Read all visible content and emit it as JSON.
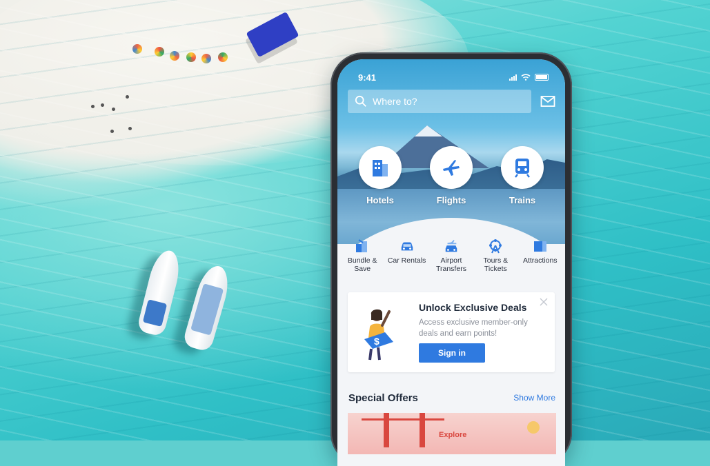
{
  "status_bar": {
    "time": "9:41"
  },
  "search": {
    "placeholder": "Where to?"
  },
  "primary_categories": [
    {
      "label": "Hotels",
      "icon": "hotel-icon"
    },
    {
      "label": "Flights",
      "icon": "plane-icon"
    },
    {
      "label": "Trains",
      "icon": "train-icon"
    }
  ],
  "secondary_categories": [
    {
      "label": "Bundle &\nSave",
      "icon": "bundle-icon"
    },
    {
      "label": "Car Rentals",
      "icon": "car-icon"
    },
    {
      "label": "Airport\nTransfers",
      "icon": "airport-car-icon"
    },
    {
      "label": "Tours &\nTickets",
      "icon": "ferris-wheel-icon"
    },
    {
      "label": "Attractions",
      "icon": "ticket-icon"
    }
  ],
  "deal_card": {
    "title": "Unlock Exclusive Deals",
    "text": "Access exclusive member-only deals and earn points!",
    "button": "Sign in"
  },
  "special_offers": {
    "title": "Special Offers",
    "more": "Show More",
    "banner_text": "Explore"
  },
  "colors": {
    "brand_blue": "#2f7ae0",
    "sea": "#3fc6c9"
  }
}
